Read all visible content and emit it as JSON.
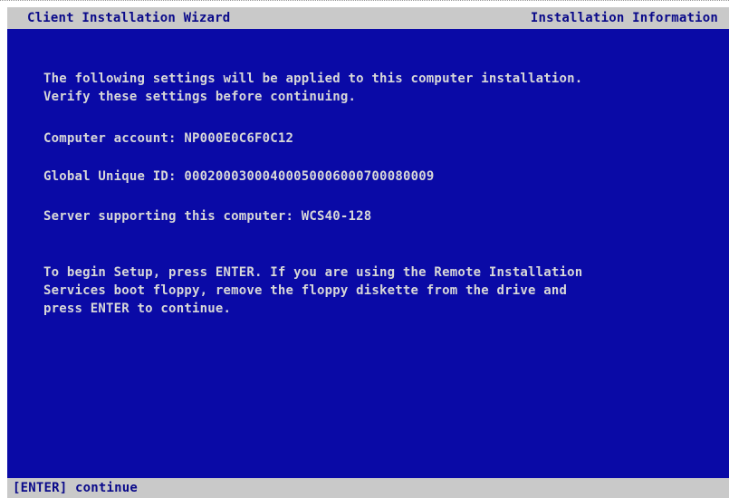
{
  "header": {
    "left_title": "Client Installation Wizard",
    "right_title": "Installation Information"
  },
  "intro": {
    "line1": "The following settings will be applied to this computer installation.",
    "line2": "Verify these settings before continuing."
  },
  "settings": {
    "computer_account_label": "Computer account:",
    "computer_account_value": "NP000E0C6F0C12",
    "guid_label": "Global Unique ID:",
    "guid_value": "00020003000400050006000700080009",
    "server_label": "Server supporting this computer:",
    "server_value": "WCS40-128"
  },
  "instructions": {
    "line1": "To begin Setup, press ENTER. If you are using the Remote Installation",
    "line2": "Services boot floppy, remove the floppy diskette from the drive and",
    "line3": "press ENTER to continue."
  },
  "status_bar": {
    "text": "[ENTER] continue"
  },
  "colors": {
    "background": "#0a0aa6",
    "text": "#d8d8d8",
    "bar": "#c9c9c9",
    "bar_text": "#0a0a8a"
  }
}
